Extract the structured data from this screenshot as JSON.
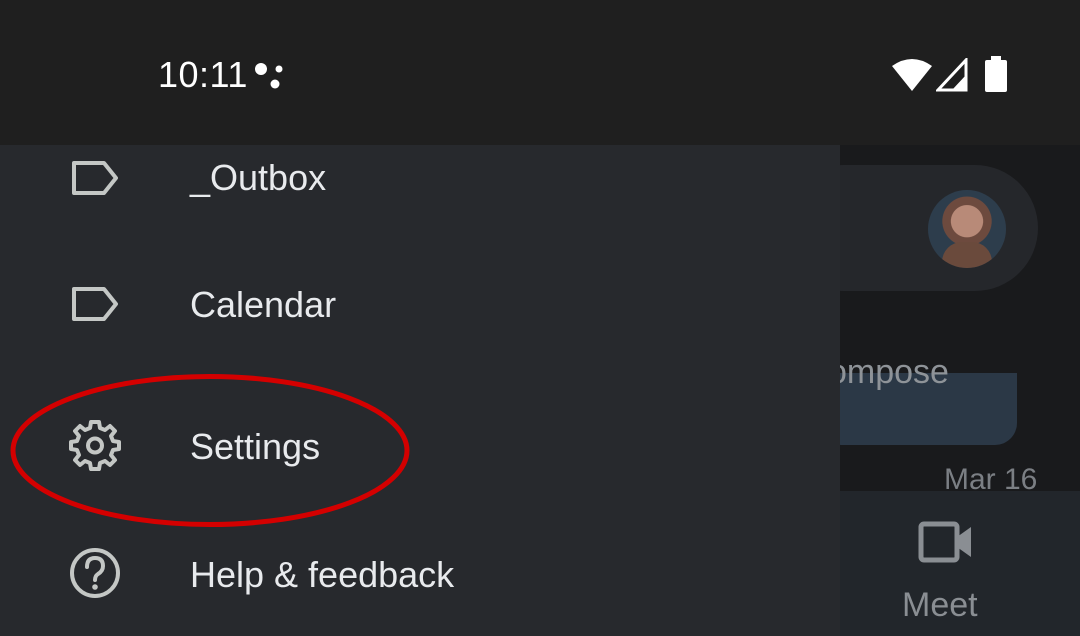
{
  "status_bar": {
    "time": "10:11",
    "icons": [
      "assistant-icon",
      "wifi-icon",
      "signal-icon",
      "battery-icon"
    ]
  },
  "drawer": {
    "items": [
      {
        "label": "_Outbox",
        "icon": "label-icon"
      },
      {
        "label": "Calendar",
        "icon": "label-icon"
      },
      {
        "label": "Settings",
        "icon": "gear-icon"
      },
      {
        "label": "Help & feedback",
        "icon": "help-icon"
      }
    ]
  },
  "background_app": {
    "compose_label": "ompose",
    "date": "Mar 16",
    "bottom_nav": {
      "meet_label": "Meet",
      "icon": "video-camera-icon"
    }
  },
  "annotation": {
    "color": "#d40000",
    "target": "Settings"
  }
}
